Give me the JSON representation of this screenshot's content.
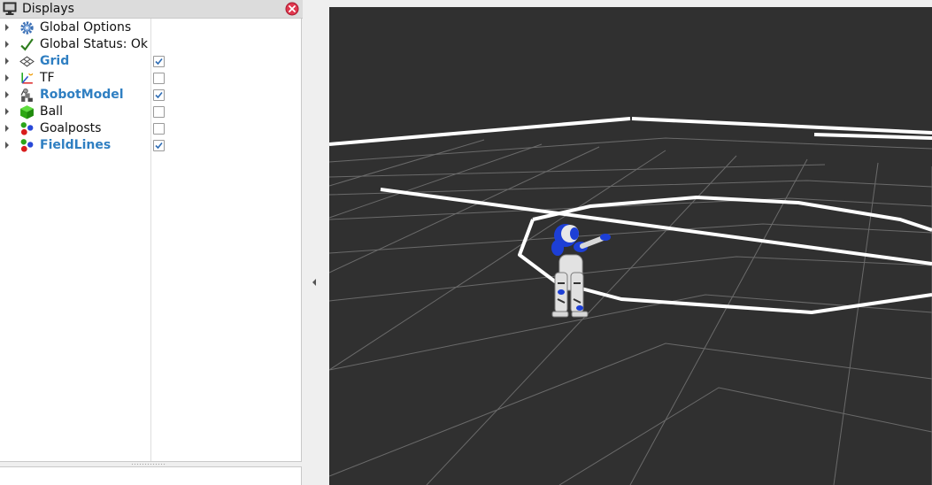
{
  "displays_panel": {
    "title": "Displays",
    "title_icon": "monitor-icon",
    "close_icon": "close-icon",
    "items": [
      {
        "label": "Global Options",
        "icon": "gear-icon",
        "enabled": false,
        "has_checkbox": false
      },
      {
        "label": "Global Status: Ok",
        "icon": "checkmark-icon",
        "enabled": false,
        "has_checkbox": false
      },
      {
        "label": "Grid",
        "icon": "grid-icon",
        "enabled": true,
        "has_checkbox": true,
        "checked": true
      },
      {
        "label": "TF",
        "icon": "axes-icon",
        "enabled": false,
        "has_checkbox": true,
        "checked": false
      },
      {
        "label": "RobotModel",
        "icon": "robot-icon",
        "enabled": true,
        "has_checkbox": true,
        "checked": true
      },
      {
        "label": "Ball",
        "icon": "green-cube-icon",
        "enabled": false,
        "has_checkbox": true,
        "checked": false
      },
      {
        "label": "Goalposts",
        "icon": "markers-icon",
        "enabled": false,
        "has_checkbox": true,
        "checked": false
      },
      {
        "label": "FieldLines",
        "icon": "markers-icon",
        "enabled": true,
        "has_checkbox": true,
        "checked": true
      }
    ]
  },
  "splitter": {
    "handle_icon": "collapse-left-icon"
  },
  "render_view": {
    "background_color": "#303030",
    "grid_color": "#a0a0a0",
    "field_line_color": "#ffffff",
    "robot_colors": {
      "body": "#e8e8e8",
      "accent": "#1d3fd6"
    }
  },
  "colors": {
    "enabled_label": "#2f7fc2",
    "panel_background": "#efefef",
    "tree_background": "#ffffff"
  }
}
